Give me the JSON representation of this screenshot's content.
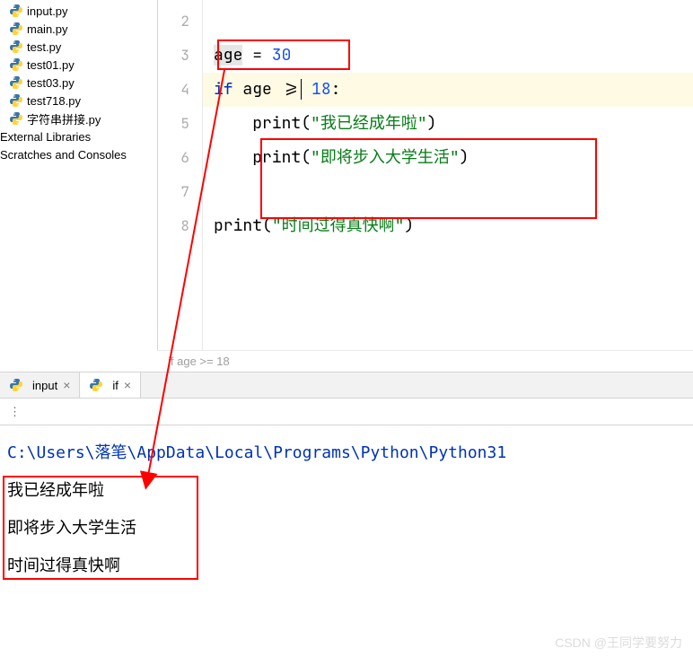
{
  "sidebar": {
    "files": [
      {
        "label": "input.py"
      },
      {
        "label": "main.py"
      },
      {
        "label": "test.py"
      },
      {
        "label": "test01.py"
      },
      {
        "label": "test03.py"
      },
      {
        "label": "test718.py"
      },
      {
        "label": "字符串拼接.py"
      }
    ],
    "libs": [
      {
        "label": "External Libraries"
      },
      {
        "label": "Scratches and Consoles"
      }
    ]
  },
  "editor": {
    "lines": [
      "2",
      "3",
      "4",
      "5",
      "6",
      "7",
      "8"
    ],
    "code3_a": "age",
    "code3_b": " = ",
    "code3_c": "30",
    "code4_a": "if",
    "code4_b": " age >=",
    "code4_c": " 18",
    "code4_d": ":",
    "code5_a": "    print",
    "code5_b": "(",
    "code5_c": "\"我已经成年啦\"",
    "code5_d": ")",
    "code6_a": "    print",
    "code6_b": "(",
    "code6_c": "\"即将步入大学生活\"",
    "code6_d": ")",
    "code8_a": "print",
    "code8_b": "(",
    "code8_c": "\"时间过得真快啊\"",
    "code8_d": ")"
  },
  "breadcrumb": "if age >= 18",
  "tabs": {
    "t1": "input",
    "t2": "if"
  },
  "toolbar": {
    "dots": "⋮"
  },
  "console": {
    "path": "C:\\Users\\落笔\\AppData\\Local\\Programs\\Python\\Python31",
    "out1": "我已经成年啦",
    "out2": "即将步入大学生活",
    "out3": "时间过得真快啊"
  },
  "watermark": "CSDN @王同学要努力"
}
